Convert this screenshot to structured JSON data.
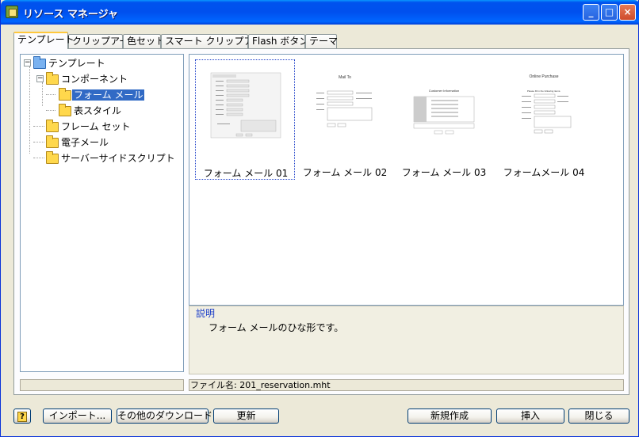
{
  "window": {
    "title": "リソース マネージャ",
    "controls": {
      "minimize": "_",
      "maximize": "□",
      "close": "×"
    }
  },
  "tabs": [
    {
      "label": "テンプレート",
      "active": true
    },
    {
      "label": "クリップアート",
      "active": false
    },
    {
      "label": "色セット",
      "active": false
    },
    {
      "label": "スマート クリップアート",
      "active": false
    },
    {
      "label": "Flash ボタン",
      "active": false
    },
    {
      "label": "テーマ",
      "active": false
    }
  ],
  "tree": {
    "root": "テンプレート",
    "items": [
      {
        "label": "コンポーネント"
      },
      {
        "label": "フォーム メール",
        "selected": true
      },
      {
        "label": "表スタイル"
      },
      {
        "label": "フレーム セット"
      },
      {
        "label": "電子メール"
      },
      {
        "label": "サーバーサイドスクリプト"
      }
    ],
    "expanders": {
      "collapse": "−"
    }
  },
  "gallery": {
    "items": [
      {
        "label": "フォーム メール 01",
        "selected": true
      },
      {
        "label": "フォーム メール 02"
      },
      {
        "label": "フォーム メール 03"
      },
      {
        "label": "フォームメール 04"
      }
    ],
    "previews": {
      "p2_title": "Mail To",
      "p3_title": "Customer Information",
      "p4_title": "Online Purchase",
      "p4_subtitle": "Please fill in the following items."
    }
  },
  "description": {
    "heading": "説明",
    "text": "フォーム メールのひな形です。"
  },
  "file": {
    "text": "ファイル名: 201_reservation.mht"
  },
  "buttons": {
    "help": "?",
    "import": "インポート...",
    "download": "その他のダウンロード...",
    "refresh": "更新",
    "create": "新規作成",
    "insert": "挿入",
    "close": "閉じる"
  },
  "colors": {
    "titlebar": "#0054e3",
    "selection": "#316ac5",
    "description_heading": "#1c3ec8"
  }
}
